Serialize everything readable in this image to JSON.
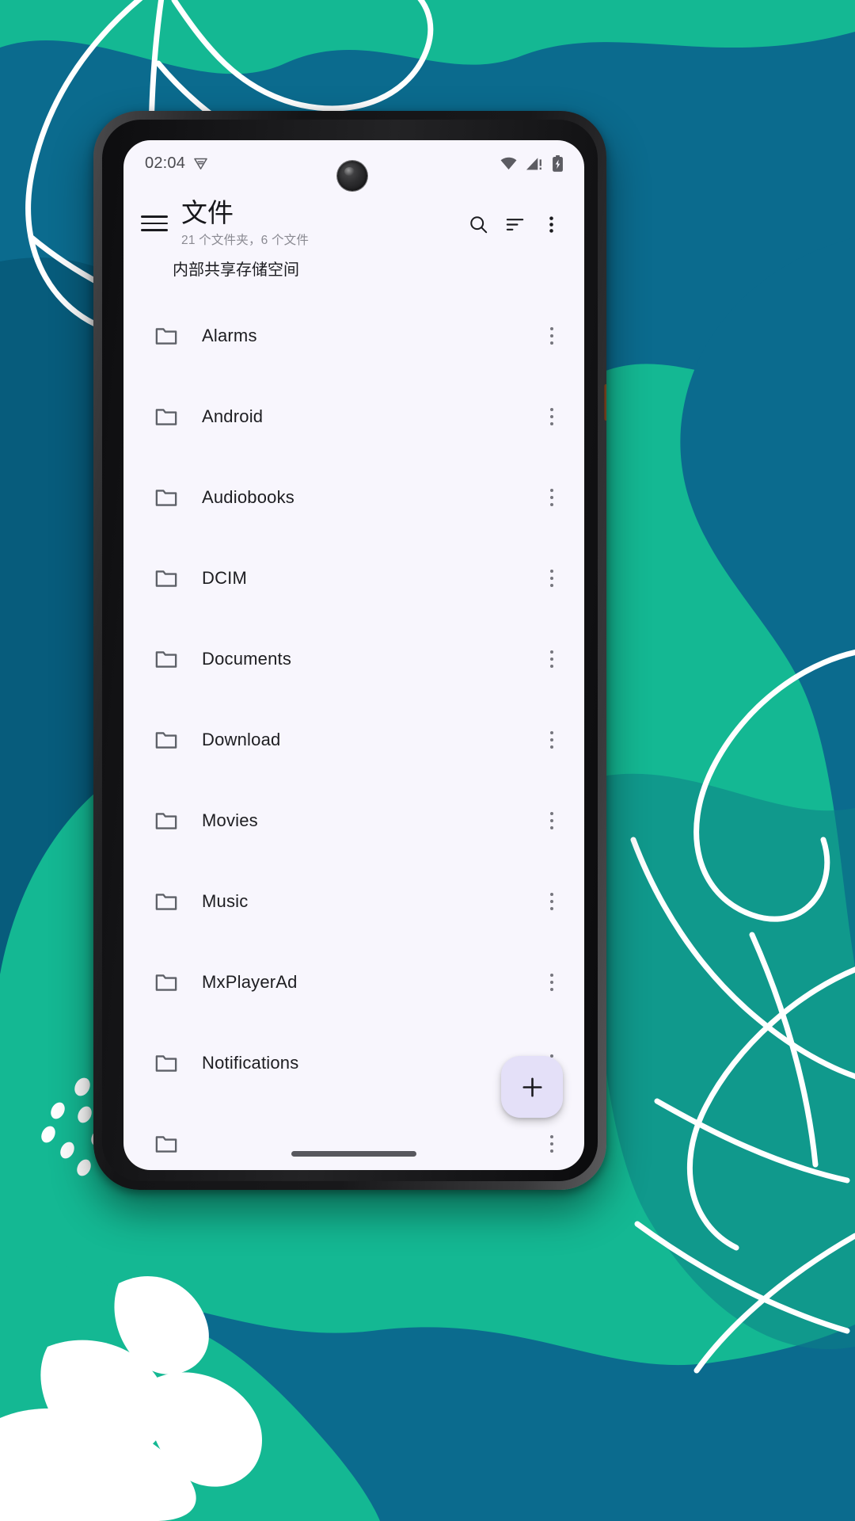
{
  "wallpaper": {
    "colors": {
      "teal": "#14b893",
      "teal_dark": "#0fa184",
      "blue": "#0b6b8e",
      "blue_deep": "#075c7c",
      "line": "#ffffff"
    }
  },
  "device": {
    "frame_color": "#1a1a1c",
    "screen_bg": "#f8f6fd",
    "camera": "front-camera-punch-hole"
  },
  "status_bar": {
    "time": "02:04",
    "icons": {
      "vpn": "vpn-key-icon",
      "wifi": "wifi-icon",
      "signal": "cellular-signal-alert-icon",
      "battery": "battery-charging-icon"
    }
  },
  "app_bar": {
    "menu_icon": "hamburger-menu-icon",
    "title": "文件",
    "subtitle": "21 个文件夹，6 个文件",
    "actions": [
      {
        "name": "search-button",
        "icon": "search-icon"
      },
      {
        "name": "sort-button",
        "icon": "sort-icon"
      },
      {
        "name": "overflow-menu-button",
        "icon": "more-vertical-icon"
      }
    ]
  },
  "section": {
    "header": "内部共享存储空间"
  },
  "list": {
    "items": [
      {
        "name": "Alarms",
        "type": "folder"
      },
      {
        "name": "Android",
        "type": "folder"
      },
      {
        "name": "Audiobooks",
        "type": "folder"
      },
      {
        "name": "DCIM",
        "type": "folder"
      },
      {
        "name": "Documents",
        "type": "folder"
      },
      {
        "name": "Download",
        "type": "folder"
      },
      {
        "name": "Movies",
        "type": "folder"
      },
      {
        "name": "Music",
        "type": "folder"
      },
      {
        "name": "MxPlayerAd",
        "type": "folder"
      },
      {
        "name": "Notifications",
        "type": "folder"
      },
      {
        "name": "",
        "type": "folder"
      }
    ]
  },
  "fab": {
    "icon": "plus-icon",
    "color": "#e4e0f8"
  },
  "nav": {
    "home_indicator": "home-gesture-bar"
  }
}
